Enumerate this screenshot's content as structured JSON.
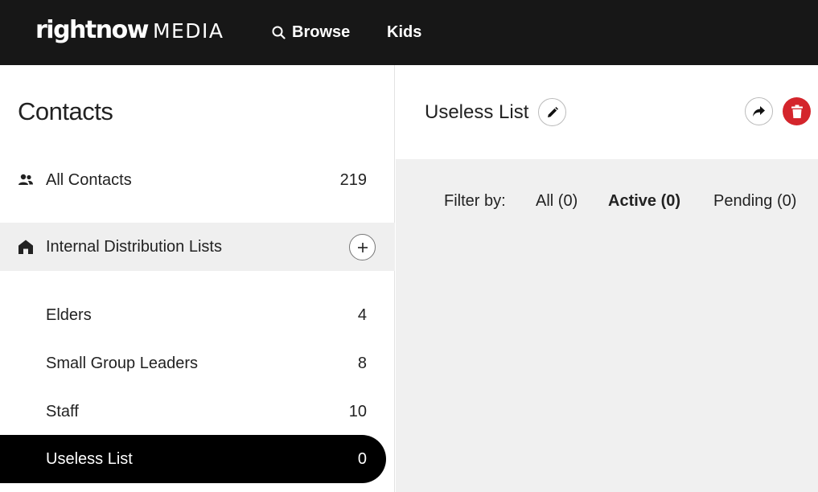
{
  "header": {
    "logo_main": "rightnow",
    "logo_sub": "MEDIA",
    "nav": [
      {
        "label": "Browse",
        "icon": "search-icon"
      },
      {
        "label": "Kids"
      }
    ]
  },
  "sidebar": {
    "title": "Contacts",
    "all_contacts": {
      "label": "All Contacts",
      "count": "219",
      "icon": "people-icon"
    },
    "internal_lists": {
      "label": "Internal Distribution Lists",
      "icon": "home-icon",
      "add_icon": "plus-icon"
    },
    "lists": [
      {
        "label": "Elders",
        "count": "4"
      },
      {
        "label": "Small Group Leaders",
        "count": "8"
      },
      {
        "label": "Staff",
        "count": "10"
      },
      {
        "label": "Useless List",
        "count": "0",
        "selected": true
      }
    ]
  },
  "main": {
    "title": "Useless List",
    "edit_icon": "pencil-icon",
    "share_icon": "share-icon",
    "delete_icon": "trash-icon",
    "filter": {
      "label": "Filter by:",
      "options": [
        {
          "label": "All (0)"
        },
        {
          "label": "Active (0)",
          "active": true
        },
        {
          "label": "Pending (0)"
        }
      ]
    }
  },
  "colors": {
    "topbar": "#171717",
    "selected_bg": "#000000",
    "section_bg": "#efefef",
    "delete_red": "#d4252c"
  }
}
